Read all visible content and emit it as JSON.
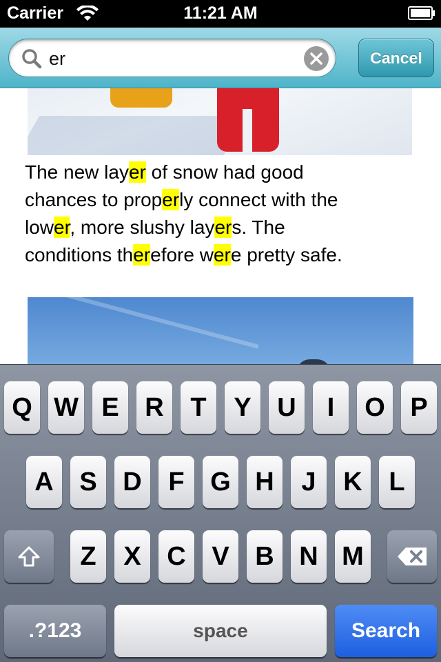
{
  "status_bar": {
    "carrier": "Carrier",
    "time": "11:21 AM"
  },
  "search": {
    "query": "er",
    "cancel_label": "Cancel"
  },
  "content": {
    "lines": [
      [
        {
          "t": "The new lay",
          "h": false
        },
        {
          "t": "er",
          "h": true
        },
        {
          "t": " of snow had good",
          "h": false
        }
      ],
      [
        {
          "t": "chances to prop",
          "h": false
        },
        {
          "t": "er",
          "h": true
        },
        {
          "t": "ly connect with the",
          "h": false
        }
      ],
      [
        {
          "t": "low",
          "h": false
        },
        {
          "t": "er",
          "h": true
        },
        {
          "t": ", more slushy lay",
          "h": false
        },
        {
          "t": "er",
          "h": true
        },
        {
          "t": "s. The",
          "h": false
        }
      ],
      [
        {
          "t": "conditions th",
          "h": false
        },
        {
          "t": "er",
          "h": true
        },
        {
          "t": "efore w",
          "h": false
        },
        {
          "t": "er",
          "h": true
        },
        {
          "t": "e pretty safe.",
          "h": false
        }
      ]
    ],
    "highlight_color": "#ffff00"
  },
  "keyboard": {
    "row1": [
      "Q",
      "W",
      "E",
      "R",
      "T",
      "Y",
      "U",
      "I",
      "O",
      "P"
    ],
    "row2": [
      "A",
      "S",
      "D",
      "F",
      "G",
      "H",
      "J",
      "K",
      "L"
    ],
    "row3": [
      "Z",
      "X",
      "C",
      "V",
      "B",
      "N",
      "M"
    ],
    "shift_icon": "shift-arrow-icon",
    "backspace_icon": "backspace-icon",
    "numbers_label": ".?123",
    "space_label": "space",
    "search_label": "Search"
  }
}
